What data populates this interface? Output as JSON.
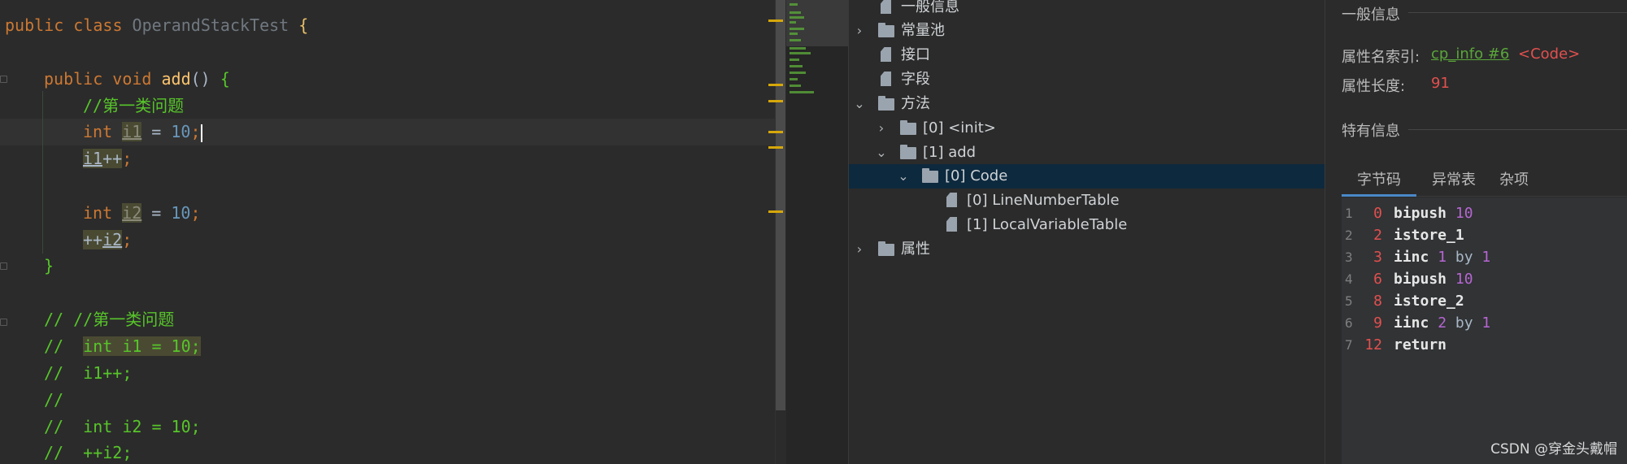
{
  "editor": {
    "class_kw": "public class",
    "class_name": "OperandStackTest",
    "open_brace": "{",
    "method_public": "public",
    "method_void": "void",
    "method_name": "add",
    "method_parens": "()",
    "comment_1": "//第一类问题",
    "int_kw": "int",
    "var_i1": "i1",
    "assign_10": " = ",
    "ten": "10",
    "semi": ";",
    "i1": "i1",
    "plusplus": "++",
    "var_i2": "i2",
    "close_brace": "}",
    "c_line_1": "// //第一类问题",
    "c_line_2_prefix": "//  ",
    "c_line_2_body": "int i1 = 10;",
    "c_line_3": "//  i1++;",
    "c_line_4": "//",
    "c_line_5": "//  int i2 = 10;",
    "c_line_6": "//  ++i2;"
  },
  "tree": {
    "items": [
      {
        "label": "一般信息",
        "icon": "file-icon"
      },
      {
        "label": "常量池",
        "icon": "folder-icon"
      },
      {
        "label": "接口",
        "icon": "file-icon"
      },
      {
        "label": "字段",
        "icon": "file-icon"
      },
      {
        "label": "方法",
        "icon": "folder-icon"
      },
      {
        "label": "[0] <init>",
        "icon": "folder-icon"
      },
      {
        "label": "[1] add",
        "icon": "folder-icon"
      },
      {
        "label": "[0] Code",
        "icon": "folder-icon"
      },
      {
        "label": "[0] LineNumberTable",
        "icon": "file-icon"
      },
      {
        "label": "[1] LocalVariableTable",
        "icon": "file-icon"
      },
      {
        "label": "属性",
        "icon": "folder-icon"
      }
    ]
  },
  "info": {
    "general_title": "一般信息",
    "attr_name_label": "属性名索引:",
    "attr_name_link": "cp_info #6",
    "attr_name_value": "<Code>",
    "attr_len_label": "属性长度:",
    "attr_len_value": "91",
    "specific_title": "特有信息",
    "tabs": [
      "字节码",
      "异常表",
      "杂项"
    ],
    "bytecode": [
      {
        "ln": "1",
        "off": "0",
        "op": "bipush",
        "a": "10",
        "by": "",
        "b": ""
      },
      {
        "ln": "2",
        "off": "2",
        "op": "istore_1",
        "a": "",
        "by": "",
        "b": ""
      },
      {
        "ln": "3",
        "off": "3",
        "op": "iinc",
        "a": "1",
        "by": "by",
        "b": "1"
      },
      {
        "ln": "4",
        "off": "6",
        "op": "bipush",
        "a": "10",
        "by": "",
        "b": ""
      },
      {
        "ln": "5",
        "off": "8",
        "op": "istore_2",
        "a": "",
        "by": "",
        "b": ""
      },
      {
        "ln": "6",
        "off": "9",
        "op": "iinc",
        "a": "2",
        "by": "by",
        "b": "1"
      },
      {
        "ln": "7",
        "off": "12",
        "op": "return",
        "a": "",
        "by": "",
        "b": ""
      }
    ]
  },
  "watermark": "CSDN @穿金头戴帽",
  "colors": {
    "accent": "#4a88c7",
    "selection": "#0d293e",
    "keyword": "#cc7832",
    "comment": "#57c52a",
    "number": "#6897bb",
    "bytecode_offset": "#e2504f",
    "bytecode_arg": "#b666d2"
  }
}
